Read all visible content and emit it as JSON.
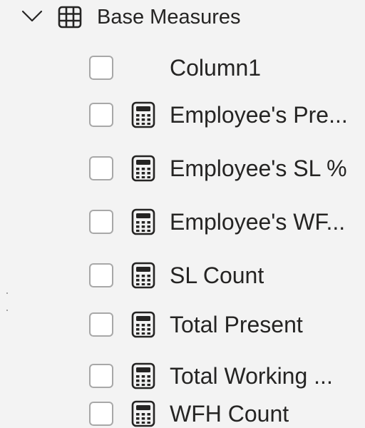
{
  "field_list": {
    "table": {
      "name": "Base Measures",
      "expanded_icon": "chevron-down-icon",
      "icon": "table-grid-icon"
    },
    "fields": [
      {
        "label": "Column1",
        "icon": "none",
        "checked": false
      },
      {
        "label": "Employee's Pre...",
        "icon": "calculator-icon",
        "checked": false
      },
      {
        "label": "Employee's SL %",
        "icon": "calculator-icon",
        "checked": false
      },
      {
        "label": "Employee's WF...",
        "icon": "calculator-icon",
        "checked": false
      },
      {
        "label": "SL Count",
        "icon": "calculator-icon",
        "checked": false
      },
      {
        "label": "Total Present",
        "icon": "calculator-icon",
        "checked": false
      },
      {
        "label": "Total Working ...",
        "icon": "calculator-icon",
        "checked": false
      },
      {
        "label": "WFH Count",
        "icon": "calculator-icon",
        "checked": false
      }
    ]
  },
  "colors": {
    "background": "#f3f3f3",
    "text": "#252423",
    "checkbox_border": "#a8a8a8",
    "icon": "#252423"
  }
}
